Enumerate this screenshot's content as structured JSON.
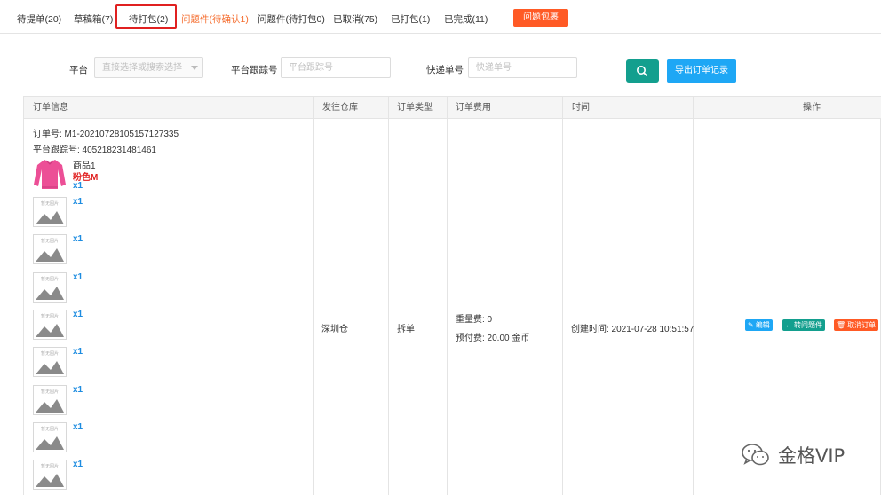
{
  "tabs": [
    {
      "label": "待提单(20)",
      "state": "normal"
    },
    {
      "label": "草稿箱(7)",
      "state": "normal"
    },
    {
      "label": "待打包(2)",
      "state": "active"
    },
    {
      "label": "问题件(待确认1)",
      "state": "warning"
    },
    {
      "label": "问题件(待打包0)",
      "state": "normal"
    },
    {
      "label": "已取消(75)",
      "state": "normal"
    },
    {
      "label": "已打包(1)",
      "state": "normal"
    },
    {
      "label": "已完成(11)",
      "state": "normal"
    }
  ],
  "problem_button": "问题包裹",
  "filters": {
    "platform_label": "平台",
    "platform_placeholder": "直接选择或搜索选择",
    "tracking_label": "平台跟踪号",
    "tracking_placeholder": "平台跟踪号",
    "express_label": "快递单号",
    "express_placeholder": "快递单号",
    "search_icon": "search-icon",
    "export_label": "导出订单记录"
  },
  "table": {
    "headers": [
      "订单信息",
      "发往仓库",
      "订单类型",
      "订单费用",
      "时间",
      "操作"
    ],
    "order": {
      "order_no": "订单号: M1-20210728105157127335",
      "platform_tracking": "平台跟踪号: 405218231481461",
      "product_name": "商品1",
      "product_variant": "粉色M",
      "items": [
        "x1",
        "x1",
        "x1",
        "x1",
        "x1",
        "x1",
        "x1",
        "x1",
        "x1"
      ],
      "no_image_text": "暂无图片",
      "warehouse": "深圳仓",
      "order_type": "拆单",
      "weight_fee": "重量费: 0",
      "prepaid_fee": "预付费: 20.00 金币",
      "created_time": "创建时间: 2021-07-28 10:51:57",
      "actions": [
        {
          "label": "编辑",
          "icon": "pencil-icon",
          "color": "#1ea7f5"
        },
        {
          "label": "转问题件",
          "icon": "arrow-left-icon",
          "color": "#139f8e"
        },
        {
          "label": "取消订单",
          "icon": "trash-icon",
          "color": "#ff5a25"
        }
      ]
    }
  },
  "watermark": "金格VIP",
  "colors": {
    "accent_orange": "#ff5a25",
    "accent_teal": "#139f8e",
    "accent_blue": "#1ea7f5",
    "active_border": "#e02020"
  }
}
